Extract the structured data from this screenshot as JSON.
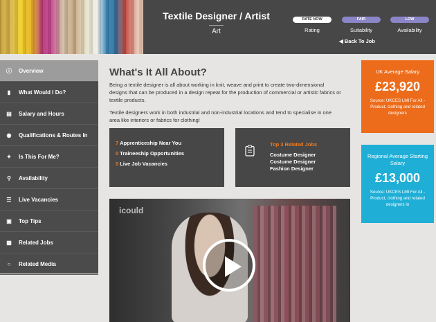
{
  "header": {
    "title": "Textile Designer / Artist",
    "subtitle": "Art",
    "back_link": "Back To Job",
    "ratings": [
      {
        "badge": "RATE NOW",
        "label": "Rating",
        "color": "#ffffff"
      },
      {
        "badge": "FAIR",
        "label": "Suitability",
        "color": "#8b86c8"
      },
      {
        "badge": "LOW",
        "label": "Availability",
        "color": "#8b86c8"
      }
    ]
  },
  "sidebar": {
    "items": [
      {
        "label": "Overview",
        "icon": "info-icon",
        "active": true
      },
      {
        "label": "What Would I Do?",
        "icon": "bar-chart-icon",
        "active": false
      },
      {
        "label": "Salary and Hours",
        "icon": "coins-icon",
        "active": false
      },
      {
        "label": "Qualifications & Routes In",
        "icon": "compass-icon",
        "active": false
      },
      {
        "label": "Is This For Me?",
        "icon": "puzzle-icon",
        "active": false
      },
      {
        "label": "Availability",
        "icon": "location-pin-icon",
        "active": false
      },
      {
        "label": "Live Vacancies",
        "icon": "list-icon",
        "active": false
      },
      {
        "label": "Top Tips",
        "icon": "briefcase-icon",
        "active": false
      },
      {
        "label": "Related Jobs",
        "icon": "document-icon",
        "active": false
      },
      {
        "label": "Related Media",
        "icon": "chat-icon",
        "active": false
      }
    ]
  },
  "main": {
    "title": "What's It All About?",
    "paragraph1": "Being a textile designer is all about working in knit, weave and print to create two-dimensional designs that can be produced in a design repeat for the production of commercial or artistic fabrics or textile products.",
    "paragraph2": "Textile designers work in both industrial and non-industrial locations and tend to specialise in one area like interiors or fabrics for clothing!",
    "stats": [
      {
        "count": "7",
        "label": "Apprenticeship Near You"
      },
      {
        "count": "0",
        "label": "Traineeship Opportunities"
      },
      {
        "count": "0",
        "label": "Live Job Vacancies"
      }
    ],
    "related": {
      "title": "Top 3 Related Jobs",
      "jobs": [
        "Costume Designer",
        "Costume Designer",
        "Fashion Designer"
      ]
    },
    "video": {
      "watermark": "icould"
    }
  },
  "salary_cards": [
    {
      "title": "UK Average Salary",
      "value": "£23,920",
      "source": "Source: UKCES LMI For All - Product, clothing and related designers",
      "color": "#ec6c1b"
    },
    {
      "title": "Regional Average Starting Salary",
      "value": "£13,000",
      "source": "Source: UKCES LMI For All - Product, clothing and related designers in",
      "color": "#1faed6"
    }
  ],
  "accent_color": "#f07a1e"
}
